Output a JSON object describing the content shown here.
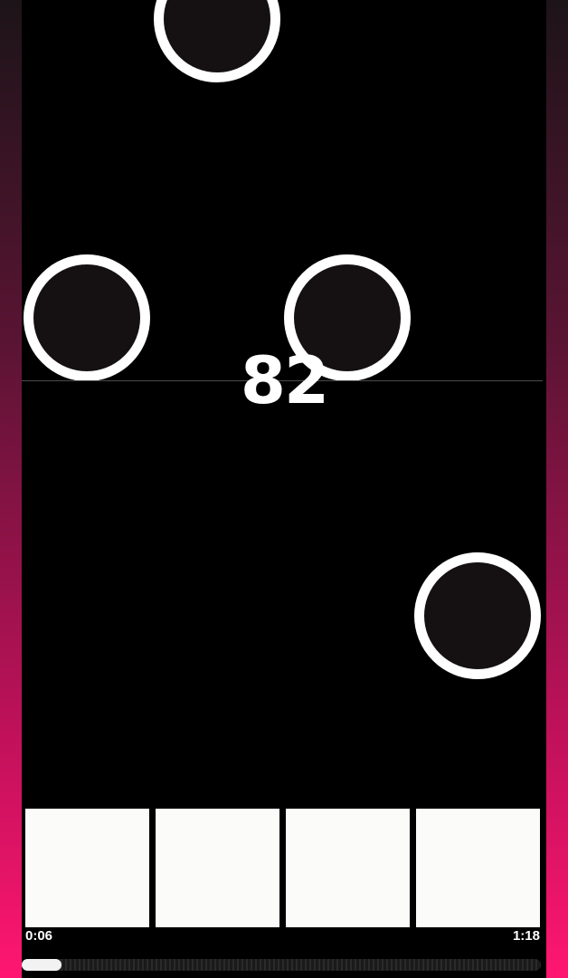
{
  "score": "82",
  "time": {
    "elapsed": "0:06",
    "total": "1:18"
  },
  "progress_fraction": 0.077,
  "colors": {
    "accent": "#ff1670",
    "note_fill": "#151112",
    "note_ring": "#ffffff",
    "lane_button": "#fbfcf9"
  },
  "lanes": [
    {
      "id": "lane-1"
    },
    {
      "id": "lane-2"
    },
    {
      "id": "lane-3"
    },
    {
      "id": "lane-4"
    }
  ],
  "notes": [
    {
      "lane": 2
    },
    {
      "lane": 1
    },
    {
      "lane": 3
    },
    {
      "lane": 4
    }
  ]
}
